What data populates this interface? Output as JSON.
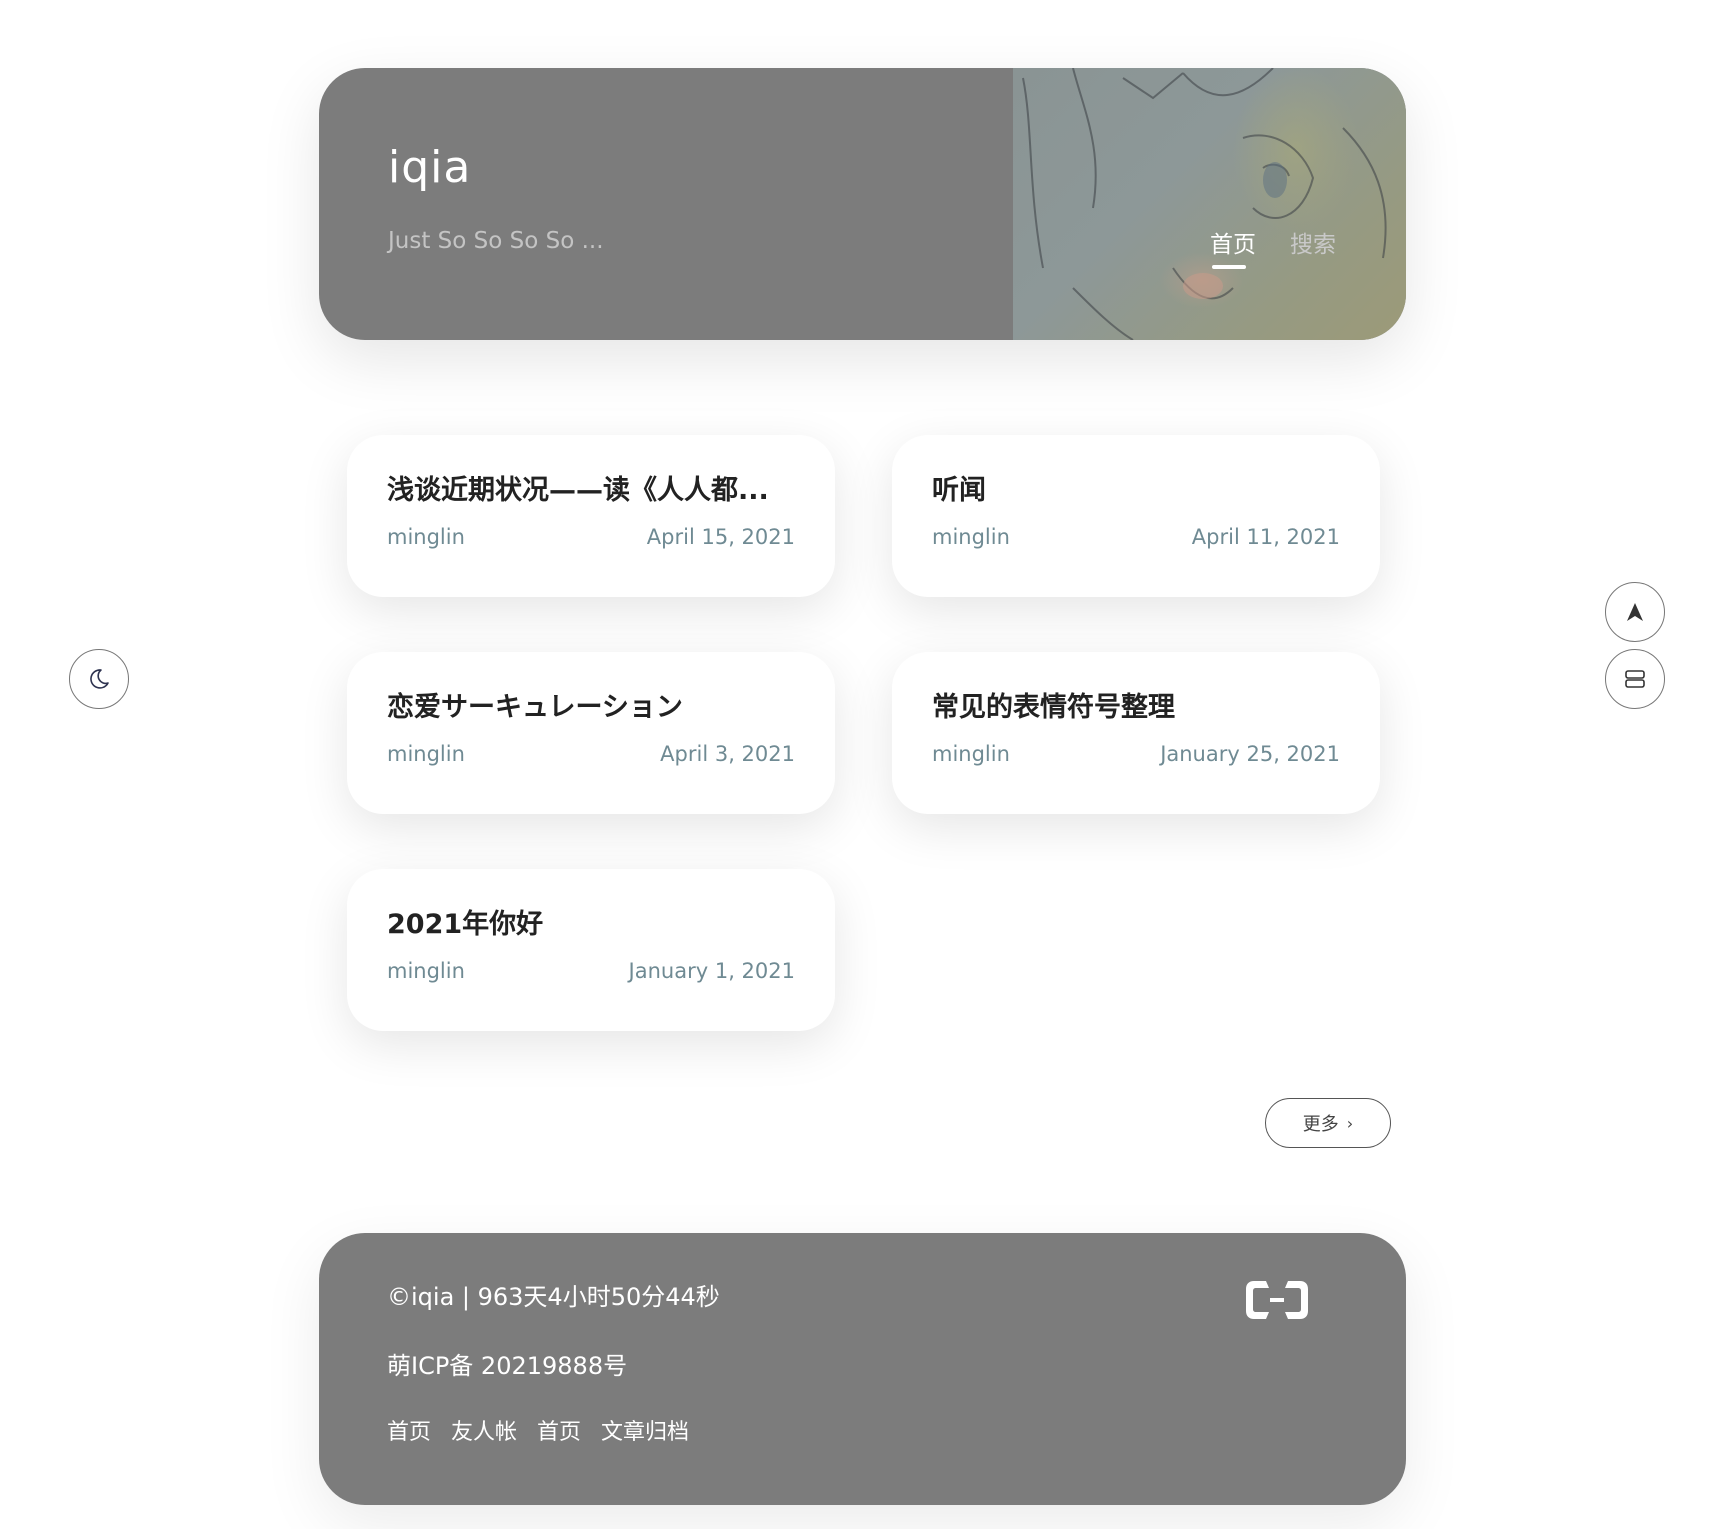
{
  "header": {
    "title": "iqia",
    "subtitle": "Just So So So So ...",
    "nav": [
      {
        "label": "首页",
        "active": true
      },
      {
        "label": "搜索",
        "active": false
      }
    ]
  },
  "posts": [
    {
      "title": "浅谈近期状况——读《人人都...",
      "author": "minglin",
      "date": "April 15, 2021"
    },
    {
      "title": "听闻",
      "author": "minglin",
      "date": "April 11, 2021"
    },
    {
      "title": "恋爱サーキュレーション",
      "author": "minglin",
      "date": "April 3, 2021"
    },
    {
      "title": "常见的表情符号整理",
      "author": "minglin",
      "date": "January 25, 2021"
    },
    {
      "title": "2021年你好",
      "author": "minglin",
      "date": "January 1, 2021"
    }
  ],
  "more_button": {
    "label": "更多",
    "icon": "chevron-right-icon"
  },
  "floating": {
    "theme_toggle_icon": "moon-icon",
    "back_to_top_icon": "arrow-up-icon",
    "toc_icon": "list-icon"
  },
  "footer": {
    "copyright": "©iqia | 963天4小时50分44秒",
    "icp": "萌ICP备 20219888号",
    "links": [
      "首页",
      "友人帐",
      "首页",
      "文章归档"
    ],
    "logo_icon": "aliyun-logo-icon"
  },
  "colors": {
    "panel": "#7c7c7c",
    "meta_text": "#6f8a93",
    "title_text": "#222222",
    "background": "#ffffff"
  }
}
